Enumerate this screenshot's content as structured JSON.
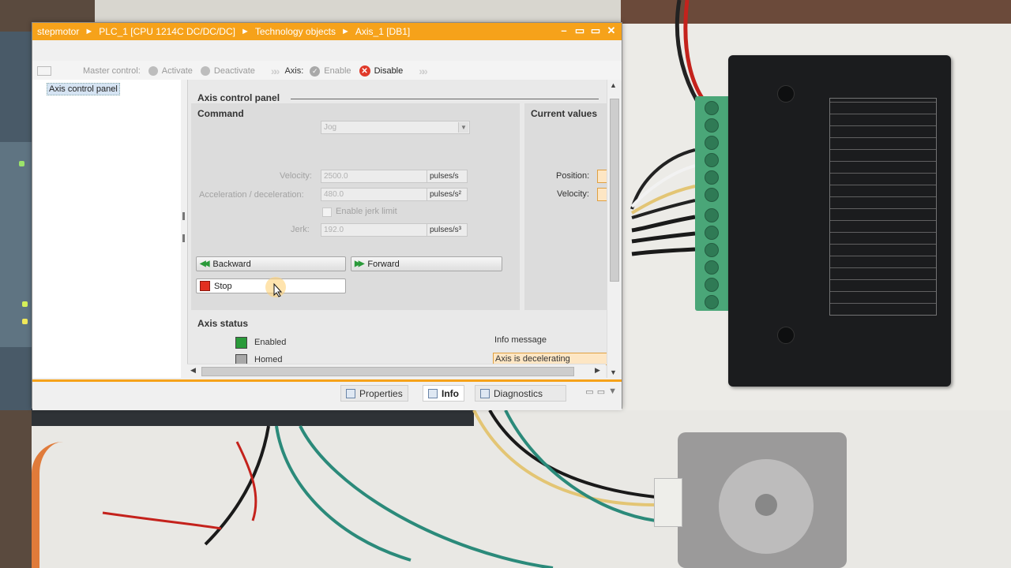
{
  "window": {
    "breadcrumb": [
      "stepmotor",
      "PLC_1 [CPU 1214C DC/DC/DC]",
      "Technology objects",
      "Axis_1 [DB1]"
    ],
    "controls": [
      "–",
      "▭",
      "▭",
      "✕"
    ]
  },
  "toolbar": {
    "master_control_label": "Master control:",
    "activate_label": "Activate",
    "deactivate_label": "Deactivate",
    "axis_label": "Axis:",
    "enable_label": "Enable",
    "disable_label": "Disable"
  },
  "nav": {
    "selected_item": "Axis control panel"
  },
  "panel": {
    "title": "Axis control panel",
    "command_heading": "Command",
    "command_value": "Jog",
    "current_values_heading": "Current values",
    "velocity_label": "Velocity:",
    "velocity_value": "2500.0",
    "velocity_unit": "pulses/s",
    "accel_label": "Acceleration / deceleration:",
    "accel_value": "480.0",
    "accel_unit": "pulses/s²",
    "jerk_checkbox_label": "Enable jerk limit",
    "jerk_label": "Jerk:",
    "jerk_value": "192.0",
    "jerk_unit": "pulses/s³",
    "position_label": "Position:",
    "cur_velocity_label": "Velocity:",
    "backward_label": "Backward",
    "forward_label": "Forward",
    "stop_label": "Stop"
  },
  "status": {
    "heading": "Axis status",
    "enabled_label": "Enabled",
    "enabled_color": "#2a9a3a",
    "homed_label": "Homed",
    "homed_color": "#a8a8a8",
    "info_message_label": "Info message",
    "info_message": "Axis is decelerating"
  },
  "bottom_tabs": {
    "properties": "Properties",
    "info": "Info",
    "diagnostics": "Diagnostics",
    "active": "info"
  },
  "colors": {
    "accent": "#f6a21a",
    "stop_red": "#e23020",
    "disable_red": "#e03a2a"
  }
}
